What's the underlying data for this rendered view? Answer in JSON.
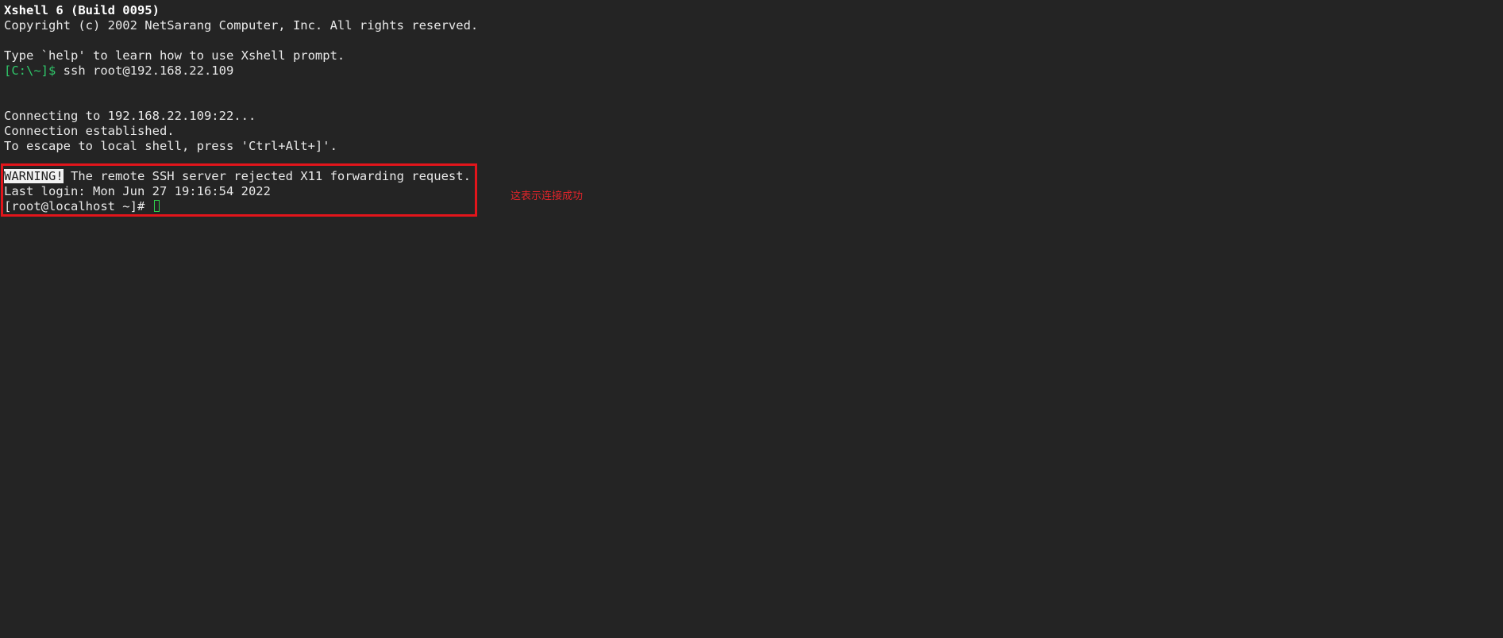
{
  "terminal": {
    "title_line": "Xshell 6 (Build 0095)",
    "copyright_line": "Copyright (c) 2002 NetSarang Computer, Inc. All rights reserved.",
    "help_line": "Type `help' to learn how to use Xshell prompt.",
    "local_prompt": "[C:\\~]$",
    "local_command": " ssh root@192.168.22.109",
    "connecting_line": "Connecting to 192.168.22.109:22...",
    "established_line": "Connection established.",
    "escape_line": "To escape to local shell, press 'Ctrl+Alt+]'.",
    "warning_label": "WARNING!",
    "warning_text": " The remote SSH server rejected X11 forwarding request.",
    "last_login_line": "Last login: Mon Jun 27 19:16:54 2022",
    "remote_prompt": "[root@localhost ~]#"
  },
  "annotation": {
    "text": "这表示连接成功",
    "color": "#e0242a"
  },
  "colors": {
    "background": "#242424",
    "foreground": "#e8e8e8",
    "local_prompt": "#2fc86a",
    "cursor": "#2fd14b",
    "highlight_border": "#e2151b"
  }
}
